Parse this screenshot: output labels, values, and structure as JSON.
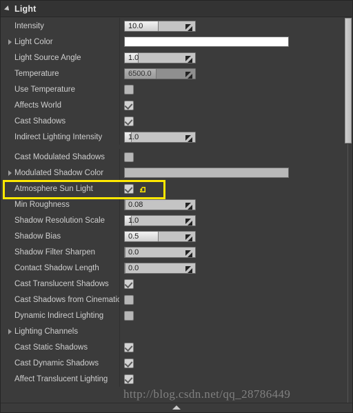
{
  "panel": {
    "category_title": "Light",
    "collapse_icon": "triangle-down-icon"
  },
  "colors": {
    "highlight": "#ffe800",
    "panel_bg": "#3b3b3b",
    "header_bg": "#333333",
    "light_color_swatch": "#ffffff",
    "modulated_shadow_color_swatch": "#b9b9b9",
    "revert_icon": "#ffe800"
  },
  "groups": [
    {
      "rows": [
        {
          "label": "Intensity",
          "expandable": false,
          "widget": "spinner",
          "value": "10.0",
          "fill_percent": 48,
          "disabled": false
        },
        {
          "label": "Light Color",
          "expandable": true,
          "widget": "color",
          "value": "#ffffff"
        },
        {
          "label": "Light Source Angle",
          "expandable": false,
          "widget": "spinner",
          "value": "1.0",
          "fill_percent": 20,
          "disabled": false
        },
        {
          "label": "Temperature",
          "expandable": false,
          "widget": "spinner",
          "value": "6500.0",
          "fill_percent": 45,
          "disabled": true
        },
        {
          "label": "Use Temperature",
          "expandable": false,
          "widget": "checkbox",
          "checked": false
        },
        {
          "label": "Affects World",
          "expandable": false,
          "widget": "checkbox",
          "checked": true
        },
        {
          "label": "Cast Shadows",
          "expandable": false,
          "widget": "checkbox",
          "checked": true
        },
        {
          "label": "Indirect Lighting Intensity",
          "expandable": false,
          "widget": "spinner",
          "value": "1.0",
          "fill_percent": 10,
          "disabled": false
        }
      ]
    },
    {
      "rows": [
        {
          "label": "Cast Modulated Shadows",
          "expandable": false,
          "widget": "checkbox",
          "checked": false
        },
        {
          "label": "Modulated Shadow Color",
          "expandable": true,
          "widget": "color",
          "value": "#b9b9b9"
        },
        {
          "label": "Atmosphere Sun Light",
          "expandable": false,
          "widget": "checkbox",
          "checked": true,
          "highlighted": true,
          "revert": true
        },
        {
          "label": "Min Roughness",
          "expandable": false,
          "widget": "spinner",
          "value": "0.08",
          "fill_percent": 0,
          "disabled": false
        },
        {
          "label": "Shadow Resolution Scale",
          "expandable": false,
          "widget": "spinner",
          "value": "1.0",
          "fill_percent": 10,
          "disabled": false
        },
        {
          "label": "Shadow Bias",
          "expandable": false,
          "widget": "spinner",
          "value": "0.5",
          "fill_percent": 48,
          "disabled": false
        },
        {
          "label": "Shadow Filter Sharpen",
          "expandable": false,
          "widget": "spinner",
          "value": "0.0",
          "fill_percent": 0,
          "disabled": false
        },
        {
          "label": "Contact Shadow Length",
          "expandable": false,
          "widget": "spinner",
          "value": "0.0",
          "fill_percent": 0,
          "disabled": false
        },
        {
          "label": "Cast Translucent Shadows",
          "expandable": false,
          "widget": "checkbox",
          "checked": true
        },
        {
          "label": "Cast Shadows from Cinematic",
          "expandable": false,
          "widget": "checkbox",
          "checked": false
        },
        {
          "label": "Dynamic Indirect Lighting",
          "expandable": false,
          "widget": "checkbox",
          "checked": false
        },
        {
          "label": "Lighting Channels",
          "expandable": true,
          "widget": "none"
        },
        {
          "label": "Cast Static Shadows",
          "expandable": false,
          "widget": "checkbox",
          "checked": true
        },
        {
          "label": "Cast Dynamic Shadows",
          "expandable": false,
          "widget": "checkbox",
          "checked": true
        },
        {
          "label": "Affect Translucent Lighting",
          "expandable": false,
          "widget": "checkbox",
          "checked": true
        }
      ]
    }
  ],
  "scrollbar": {
    "icon": "vertical-scrollbar"
  },
  "bottom": {
    "handle_icon": "triangle-up-icon"
  },
  "watermark": {
    "text": "http://blog.csdn.net/qq_28786449"
  }
}
